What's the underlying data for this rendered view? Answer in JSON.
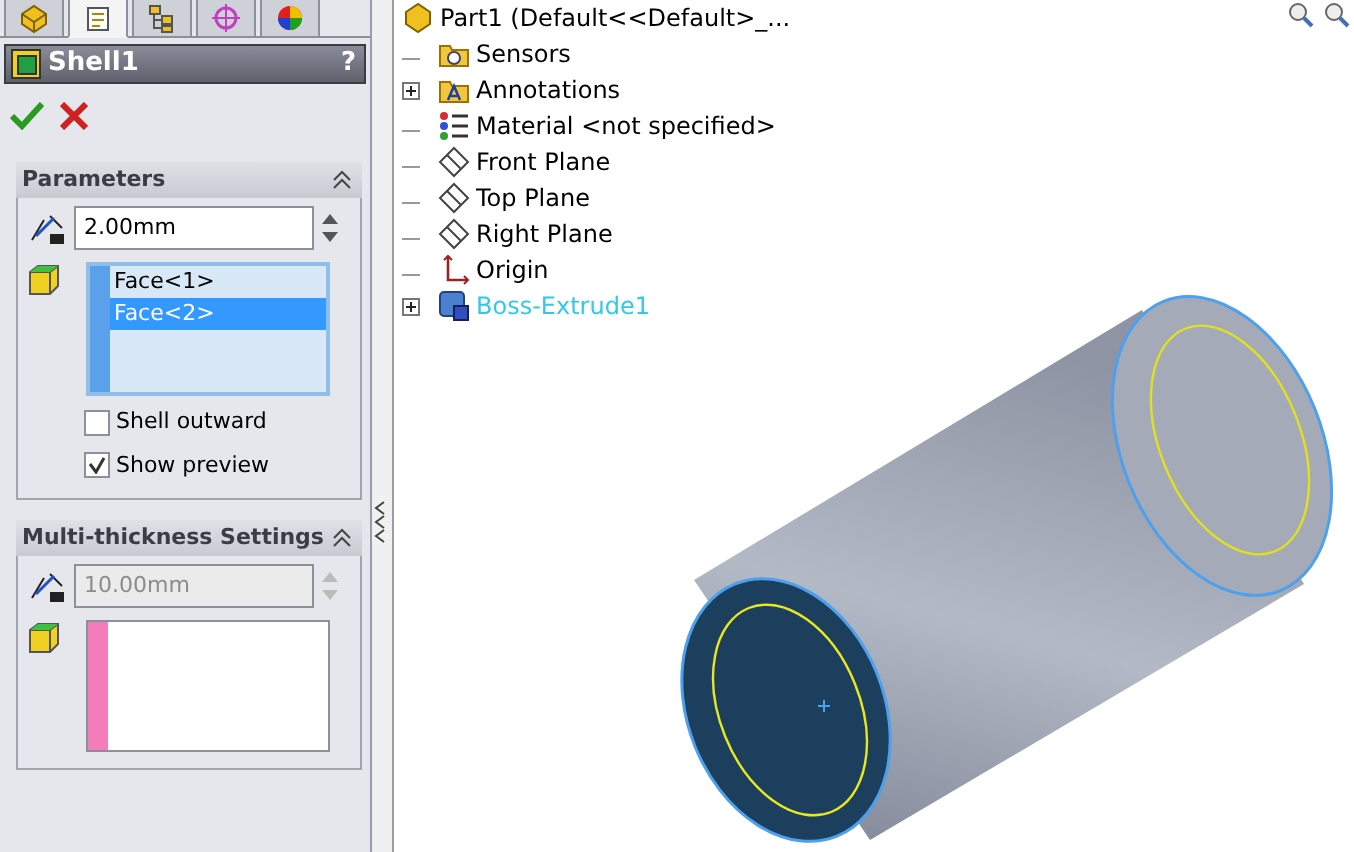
{
  "tabs": [
    {
      "kind": "part",
      "selected": false
    },
    {
      "kind": "property",
      "selected": true
    },
    {
      "kind": "config",
      "selected": false
    },
    {
      "kind": "target",
      "selected": false
    },
    {
      "kind": "appearance",
      "selected": false
    }
  ],
  "feature": {
    "title": "Shell1",
    "help": "?"
  },
  "parameters": {
    "title": "Parameters",
    "thickness": {
      "value": "2.00mm",
      "disabled": false
    },
    "faces": [
      {
        "label": "Face<1>",
        "selected": false
      },
      {
        "label": "Face<2>",
        "selected": true
      }
    ],
    "options": [
      {
        "label": "Shell outward",
        "checked": false
      },
      {
        "label": "Show preview",
        "checked": true
      }
    ]
  },
  "multi_thickness": {
    "title": "Multi-thickness Settings",
    "thickness": {
      "value": "10.00mm",
      "disabled": true
    }
  },
  "tree": {
    "label": "Part1  (Default<<Default>_...",
    "kind": "part",
    "children": [
      {
        "label": "Sensors",
        "kind": "sensors",
        "expandable": false,
        "highlighted": false
      },
      {
        "label": "Annotations",
        "kind": "annotations",
        "expandable": true,
        "highlighted": false
      },
      {
        "label": "Material <not specified>",
        "kind": "material",
        "expandable": false,
        "highlighted": false
      },
      {
        "label": "Front Plane",
        "kind": "plane",
        "expandable": false,
        "highlighted": false
      },
      {
        "label": "Top Plane",
        "kind": "plane",
        "expandable": false,
        "highlighted": false
      },
      {
        "label": "Right Plane",
        "kind": "plane",
        "expandable": false,
        "highlighted": false
      },
      {
        "label": "Origin",
        "kind": "origin",
        "expandable": false,
        "highlighted": false
      },
      {
        "label": "Boss-Extrude1",
        "kind": "feature",
        "expandable": true,
        "highlighted": true
      }
    ]
  }
}
